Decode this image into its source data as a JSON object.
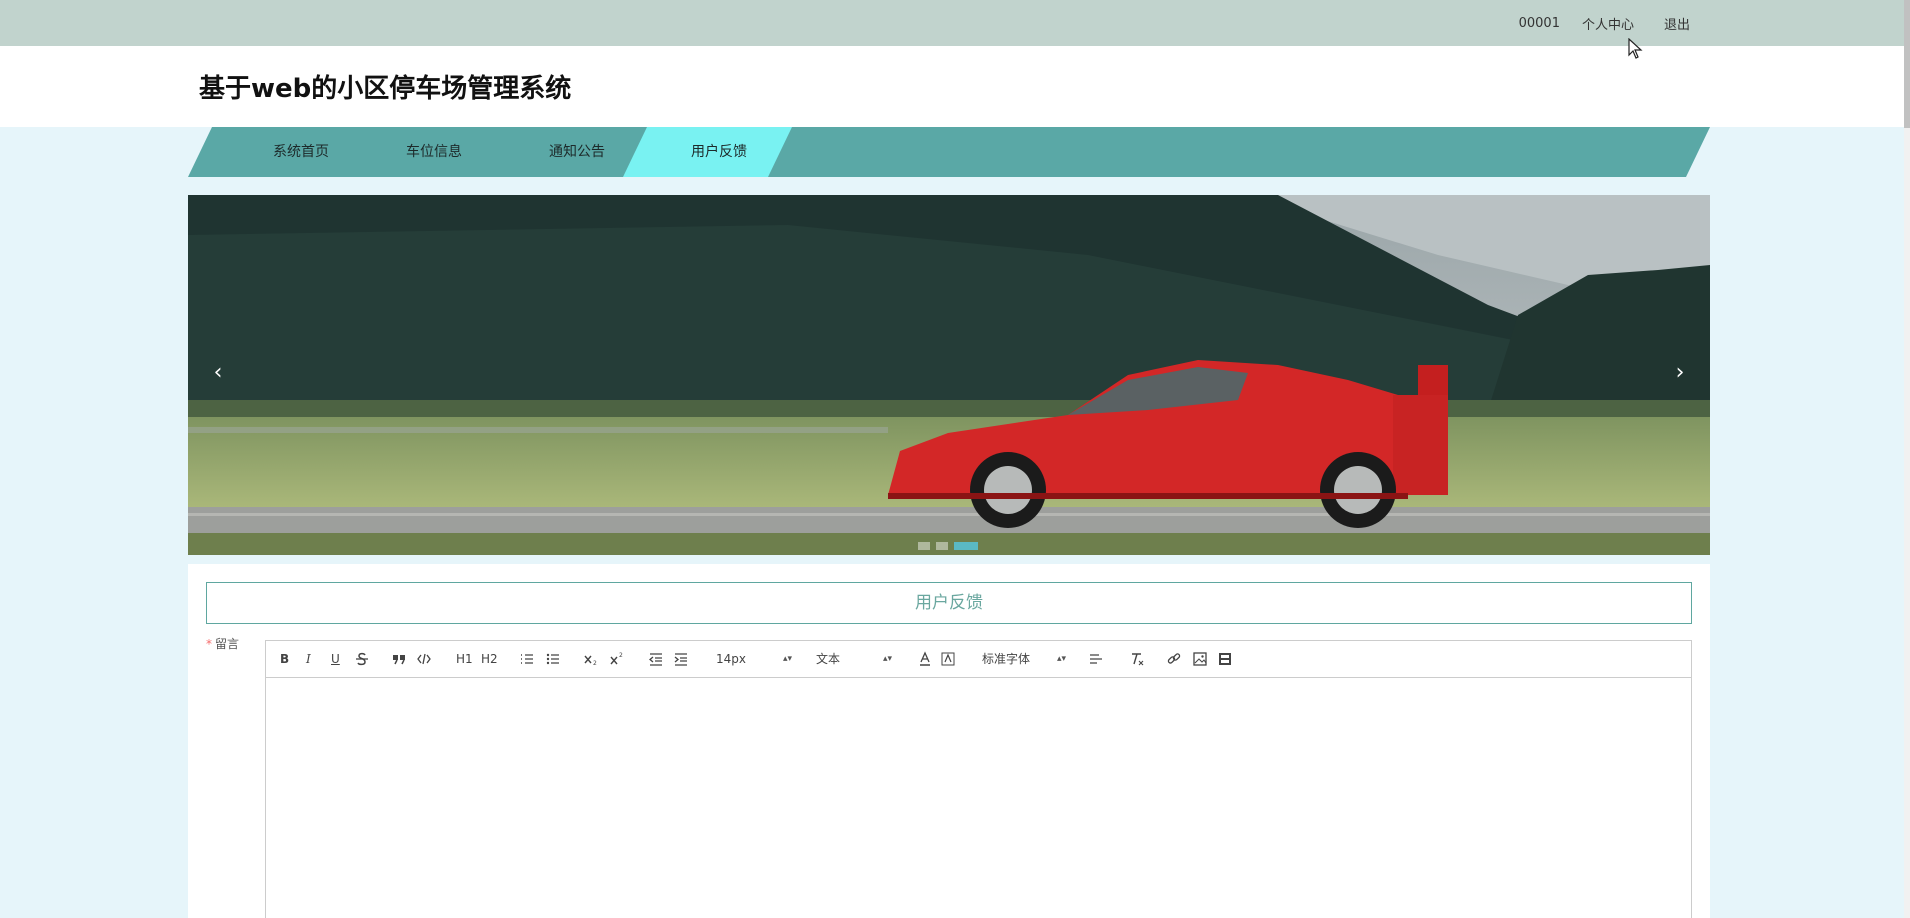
{
  "topbar": {
    "user_id": "00001",
    "profile": "个人中心",
    "logout": "退出"
  },
  "header": {
    "title": "基于web的小区停车场管理系统"
  },
  "nav": {
    "items": [
      {
        "label": "系统首页",
        "active": false
      },
      {
        "label": "车位信息",
        "active": false
      },
      {
        "label": "通知公告",
        "active": false
      },
      {
        "label": "用户反馈",
        "active": true
      }
    ]
  },
  "banner": {
    "prev": "‹",
    "next": "›",
    "slide_count": 3,
    "active_slide": 3
  },
  "feedback": {
    "title": "用户反馈",
    "field_label": "留言",
    "required_mark": "*",
    "toolbar": {
      "bold": "B",
      "italic": "I",
      "underline": "U",
      "h1": "H1",
      "h2": "H2",
      "size": "14px",
      "header_picker": "文本",
      "font_picker": "标准字体"
    }
  },
  "colors": {
    "topbar": "#c1d3cd",
    "nav": "#5aa8a6",
    "nav_active": "#79f2f2",
    "accent_text": "#6aa79f",
    "page_bg": "#e6f5fa"
  }
}
